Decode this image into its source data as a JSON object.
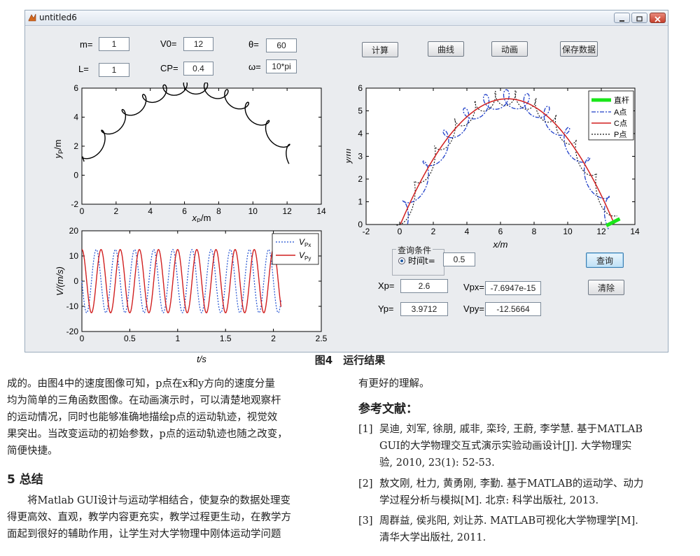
{
  "window": {
    "title": "untitled6"
  },
  "params": {
    "m_label": "m=",
    "m_value": "1",
    "L_label": "L=",
    "L_value": "1",
    "v0_label": "V0=",
    "v0_value": "12",
    "cp_label": "CP=",
    "cp_value": "0.4",
    "theta_label": "θ=",
    "theta_value": "60",
    "omega_label": "ω=",
    "omega_value": "10*pi"
  },
  "buttons": {
    "calc": "计算",
    "curve": "曲线",
    "anim": "动画",
    "save": "保存数据",
    "query": "查询",
    "clear": "清除"
  },
  "query": {
    "group_title": "查询条件",
    "radio_label": "时间t=",
    "t_value": "0.5",
    "xp_label": "Xp=",
    "xp_value": "2.6",
    "yp_label": "Yp=",
    "yp_value": "3.9712",
    "vpx_label": "Vpx=",
    "vpx_value": "-7.6947e-15",
    "vpy_label": "Vpy=",
    "vpy_value": "-12.5664"
  },
  "axes_labels": {
    "plot1_x_main": "x",
    "plot1_x_sub": "P",
    "plot1_x_unit": "/m",
    "plot1_y_main": "y",
    "plot1_y_sub": "P",
    "plot1_y_unit": "/m",
    "plot2_x": "t/s",
    "plot2_y": "V/(m/s)",
    "plot3_x": "x/m",
    "plot3_y": "y/m"
  },
  "legend2": {
    "vpx_main": "V",
    "vpx_sub": "Px",
    "vpy_main": "V",
    "vpy_sub": "Py"
  },
  "legend3": {
    "rod": "直杆",
    "a": "A点",
    "c": "C点",
    "p": "P点"
  },
  "colors": {
    "vpx": "#1f4fd1",
    "vpy": "#d11f1f",
    "rod": "#19e619",
    "a": "#1f3fc8",
    "c": "#d11f1f",
    "p": "#111111",
    "trajectory": "#000000"
  },
  "chart_data": [
    {
      "type": "line",
      "xlabel": "xP/m",
      "ylabel": "yP/m",
      "xlim": [
        0,
        14
      ],
      "ylim": [
        -2,
        6
      ],
      "xticks": [
        0,
        2,
        4,
        6,
        8,
        10,
        12,
        14
      ],
      "yticks": [
        -2,
        0,
        2,
        4,
        6
      ],
      "series": [
        {
          "values_note_free": true
        }
      ]
    },
    {
      "type": "line",
      "xlabel": "t/s",
      "ylabel": "V/(m/s)",
      "xlim": [
        0,
        2.5
      ],
      "ylim": [
        -20,
        20
      ],
      "xticks": [
        0,
        0.5,
        1,
        1.5,
        2,
        2.5
      ],
      "yticks": [
        -20,
        -10,
        0,
        10,
        20
      ],
      "series": [
        {
          "name": "VPx",
          "amplitude": 12.5664,
          "frequency_hz": 5,
          "t_end": 2.08
        },
        {
          "name": "VPy",
          "amplitude": 12.5664,
          "frequency_hz": 5,
          "t_end": 2.08
        }
      ]
    },
    {
      "type": "line",
      "xlabel": "x/m",
      "ylabel": "y/m",
      "xlim": [
        -2,
        14
      ],
      "ylim": [
        0,
        6
      ],
      "xticks": [
        -2,
        0,
        2,
        4,
        6,
        8,
        10,
        12,
        14
      ],
      "yticks": [
        0,
        1,
        2,
        3,
        4,
        5,
        6
      ],
      "series": [
        {
          "name": "直杆"
        },
        {
          "name": "A点"
        },
        {
          "name": "C点"
        },
        {
          "name": "P点"
        }
      ]
    }
  ],
  "figure_caption": "图4　运行结果",
  "body": {
    "left_paragraph1": [
      "成的。由图4中的速度图像可知，p点在x和y方向的速度分量",
      "均为简单的三角函数图像。在动画演示时，可以清楚地观察杆",
      "的运动情况，同时也能够准确地描绘p点的运动轨迹，视觉效",
      "果突出。当改变运动的初始参数，p点的运动轨迹也随之改变，",
      "简便快捷。"
    ],
    "section_title": "5 总结",
    "left_paragraph2": [
      "　　将Matlab GUI设计与运动学相结合，使复杂的数据处理变",
      "得更高效、直观，教学内容更充实，教学过程更生动，在教学方",
      "面起到很好的辅助作用，让学生对大学物理中刚体运动学问题"
    ],
    "right_line1": "有更好的理解。",
    "ref_title": "参考文献：",
    "refs": [
      {
        "num": "[1]",
        "line1": "吴迪, 刘军, 徐朋, 戚非, 栾玲, 王蔚, 李学慧. 基于MATLAB",
        "line2": "GUI的大学物理交互式演示实验动画设计[J]. 大学物理实",
        "line3": "验, 2010, 23(1): 52-53."
      },
      {
        "num": "[2]",
        "line1": "敖文刚, 杜力, 黄勇刚, 李勤. 基于MATLAB的运动学、动力",
        "line2": "学过程分析与模拟[M]. 北京: 科学出版社, 2013."
      },
      {
        "num": "[3]",
        "line1": "周群益, 侯兆阳, 刘让苏. MATLAB可视化大学物理学[M].",
        "line2": "清华大学出版社, 2011."
      }
    ]
  }
}
